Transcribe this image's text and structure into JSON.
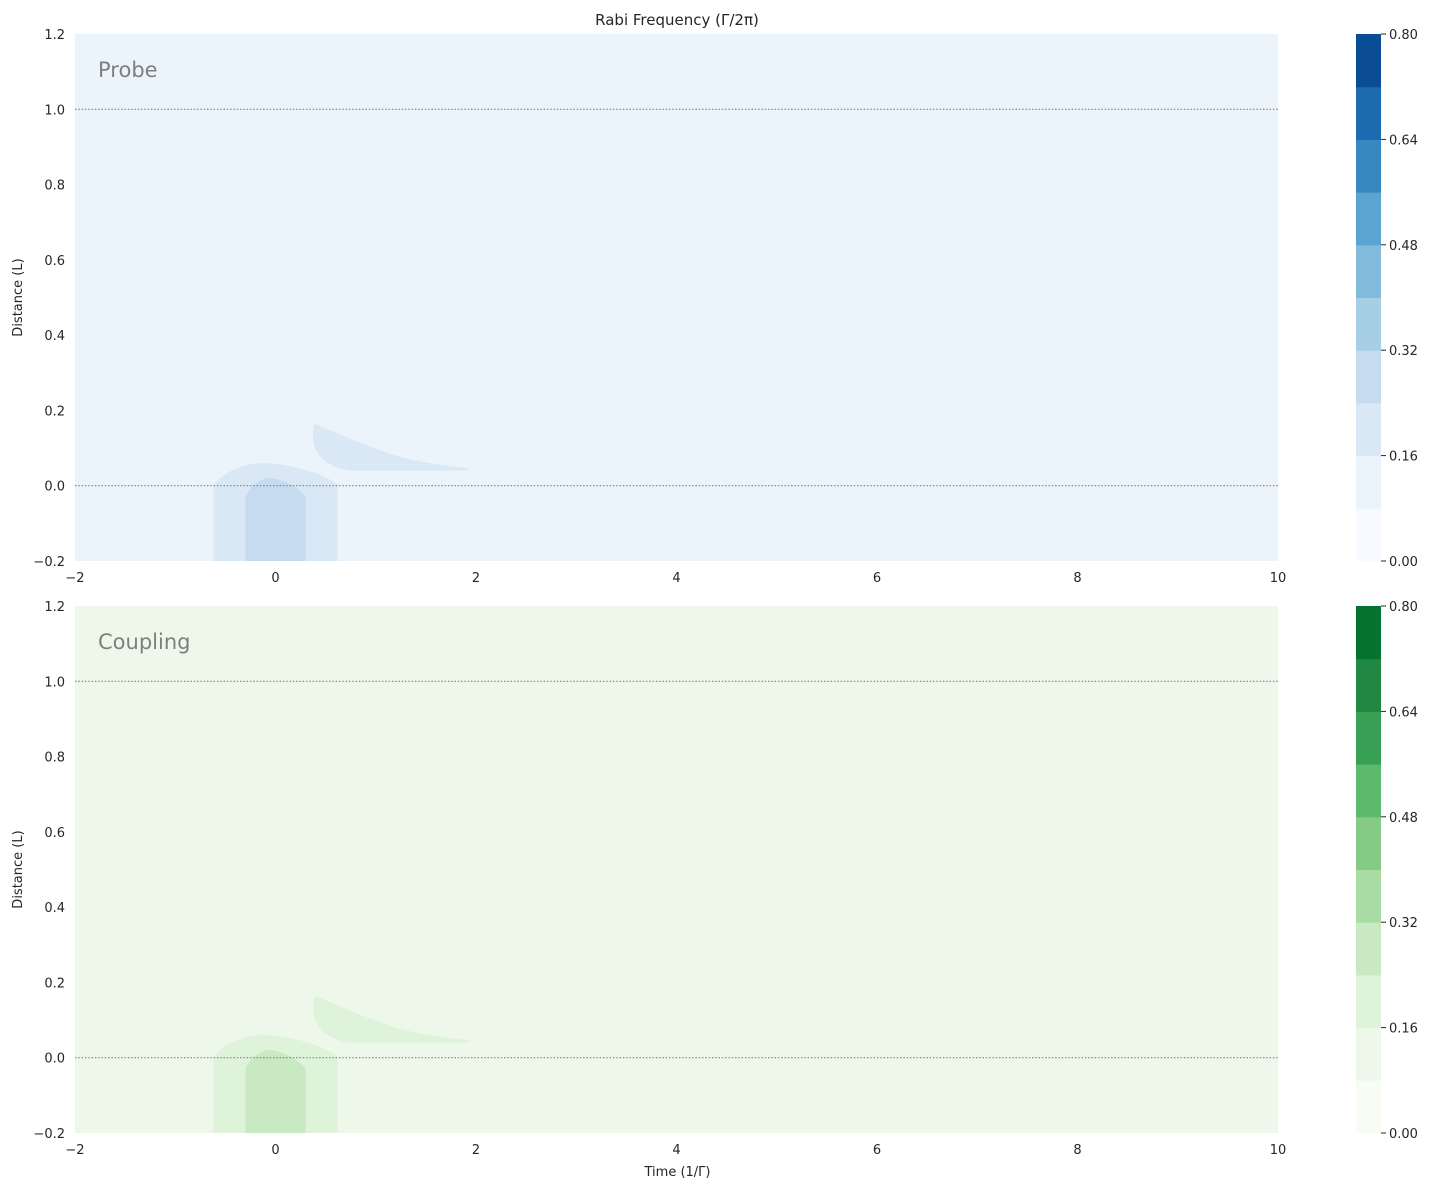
{
  "figure": {
    "title": "Rabi Frequency (Γ/2π)",
    "xlabel": "Time (1/Γ)",
    "ylabel": "Distance (L)"
  },
  "chart_data": [
    {
      "type": "heatmap",
      "panel_label": "Probe",
      "xlabel": "",
      "ylabel": "Distance (L)",
      "xlim": [
        -2,
        10
      ],
      "ylim": [
        -0.2,
        1.2
      ],
      "x_ticks": [
        "−2",
        "0",
        "2",
        "4",
        "6",
        "8",
        "10"
      ],
      "y_ticks": [
        "−0.2",
        "0.0",
        "0.2",
        "0.4",
        "0.6",
        "0.8",
        "1.0",
        "1.2"
      ],
      "reference_lines_y": [
        0.0,
        1.0
      ],
      "colormap": "Blues",
      "colorbar_range": [
        0.0,
        0.8
      ],
      "colorbar_levels": 10,
      "colorbar_ticks": [
        "0.00",
        "0.16",
        "0.32",
        "0.48",
        "0.64",
        "0.80"
      ],
      "level_colors": [
        "#f7fbff",
        "#ebf3fb",
        "#dae8f6",
        "#c6dbef",
        "#a6cee4",
        "#82badb",
        "#5ba3d0",
        "#3787c0",
        "#1c6aaf",
        "#0b4d94",
        "#08306b"
      ],
      "background_value": 0.02,
      "regions": [
        {
          "level": 1,
          "shape": "rounded-pulse",
          "x_range": [
            -0.62,
            0.62
          ],
          "y_top": 0.06
        },
        {
          "level": 2,
          "shape": "rounded-pulse",
          "x_range": [
            -0.3,
            0.3
          ],
          "y_top": 0.02
        },
        {
          "level": 1,
          "shape": "tail",
          "x_range": [
            0.35,
            1.95
          ],
          "y_range": [
            0.04,
            0.165
          ]
        }
      ]
    },
    {
      "type": "heatmap",
      "panel_label": "Coupling",
      "xlabel": "Time (1/Γ)",
      "ylabel": "Distance (L)",
      "xlim": [
        -2,
        10
      ],
      "ylim": [
        -0.2,
        1.2
      ],
      "x_ticks": [
        "−2",
        "0",
        "2",
        "4",
        "6",
        "8",
        "10"
      ],
      "y_ticks": [
        "−0.2",
        "0.0",
        "0.2",
        "0.4",
        "0.6",
        "0.8",
        "1.0",
        "1.2"
      ],
      "reference_lines_y": [
        0.0,
        1.0
      ],
      "colormap": "Greens",
      "colorbar_range": [
        0.0,
        0.8
      ],
      "colorbar_levels": 10,
      "colorbar_ticks": [
        "0.00",
        "0.16",
        "0.32",
        "0.48",
        "0.64",
        "0.80"
      ],
      "level_colors": [
        "#f7fcf5",
        "#edf8ea",
        "#dff2da",
        "#c8e9c1",
        "#a9dca3",
        "#85cb86",
        "#5db96b",
        "#38a055",
        "#208843",
        "#067230",
        "#00441b"
      ],
      "background_value": 0.02,
      "regions": [
        {
          "level": 1,
          "shape": "rounded-pulse",
          "x_range": [
            -0.62,
            0.62
          ],
          "y_top": 0.06
        },
        {
          "level": 2,
          "shape": "rounded-pulse",
          "x_range": [
            -0.3,
            0.3
          ],
          "y_top": 0.02
        },
        {
          "level": 1,
          "shape": "tail",
          "x_range": [
            0.35,
            1.95
          ],
          "y_range": [
            0.04,
            0.165
          ]
        }
      ]
    }
  ]
}
